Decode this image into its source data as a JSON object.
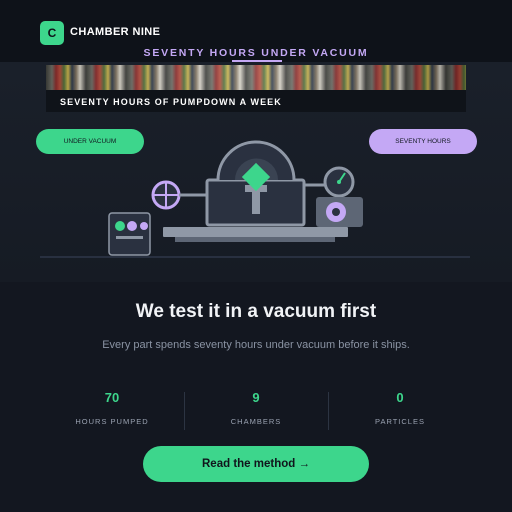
{
  "header": {
    "logo_letter": "C",
    "brand": "CHAMBER NINE",
    "tagline": "SEVENTY HOURS UNDER VACUUM"
  },
  "hero": {
    "caption": "SEVENTY HOURS OF PUMPDOWN A WEEK",
    "pill_left": "UNDER VACUUM",
    "pill_right": "SEVENTY HOURS"
  },
  "main": {
    "headline": "We test it in a vacuum first",
    "subtext": "Every part spends seventy hours under vacuum before it ships."
  },
  "stats": [
    {
      "value": "70",
      "label": "HOURS PUMPED"
    },
    {
      "value": "9",
      "label": "CHAMBERS"
    },
    {
      "value": "0",
      "label": "PARTICLES"
    }
  ],
  "cta": {
    "label": "Read the method →"
  },
  "colors": {
    "accent_green": "#3dd68c",
    "accent_purple": "#c4a8f5",
    "background": "#131720"
  }
}
